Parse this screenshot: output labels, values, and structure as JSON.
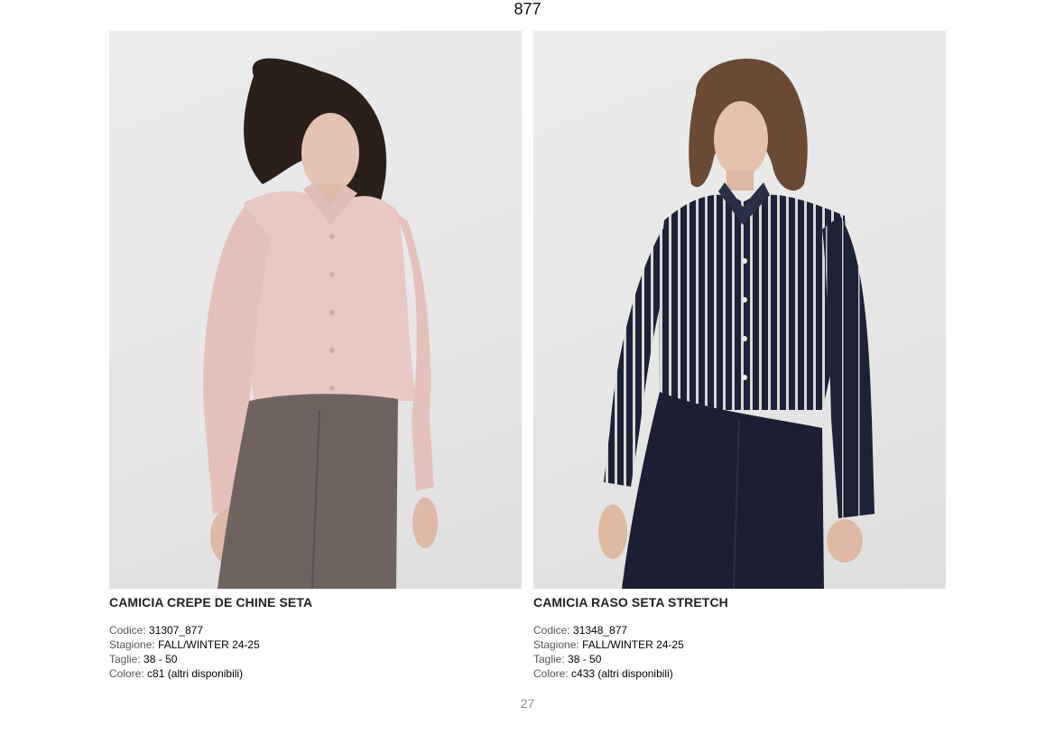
{
  "header": {
    "brand": "877"
  },
  "products": [
    {
      "title": "CAMICIA CREPE DE CHINE SETA",
      "photo_desc": "model-in-pink-silk-shirt",
      "specs": [
        {
          "label": "Codice:",
          "value": "31307_877"
        },
        {
          "label": "Stagione:",
          "value": "FALL/WINTER 24-25"
        },
        {
          "label": "Taglie:",
          "value": "38 - 50"
        },
        {
          "label": "Colore:",
          "value": "c81 (altri disponibili)"
        }
      ]
    },
    {
      "title": "CAMICIA RASO SETA STRETCH",
      "photo_desc": "model-in-striped-satin-shirt",
      "specs": [
        {
          "label": "Codice:",
          "value": "31348_877"
        },
        {
          "label": "Stagione:",
          "value": "FALL/WINTER 24-25"
        },
        {
          "label": "Taglie:",
          "value": "38 - 50"
        },
        {
          "label": "Colore:",
          "value": "c433 (altri disponibili)"
        }
      ]
    }
  ],
  "footer": {
    "page_number": "27"
  },
  "colors": {
    "background": "#ffffff",
    "photo_bg": "#e8e8e8",
    "shirt_pink": "#e9c7c2",
    "trousers_taupe": "#6f6360",
    "shirt_navy": "#1e2236",
    "trousers_navy": "#1c1f33",
    "page_number": "#8a8a8a"
  }
}
